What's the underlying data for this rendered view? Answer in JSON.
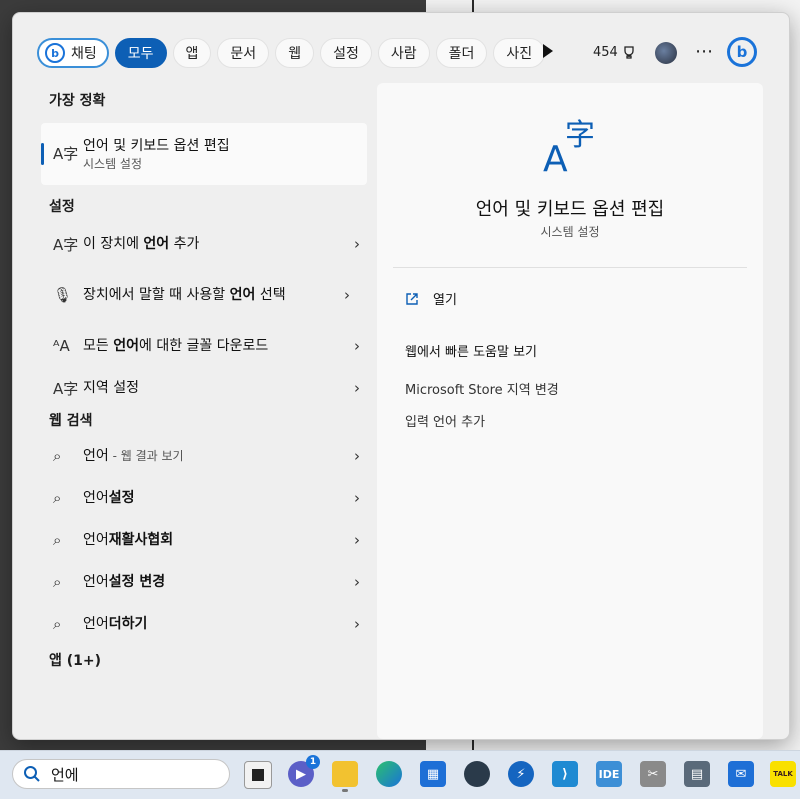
{
  "filters": {
    "chat_label": "채팅",
    "tabs": [
      "모두",
      "앱",
      "문서",
      "웹",
      "설정",
      "사람",
      "폴더",
      "사진"
    ],
    "active": "모두"
  },
  "points": "454",
  "more_icon": "⋯",
  "left": {
    "best_match": {
      "heading": "가장 정확",
      "title": "언어 및 키보드 옵션 편집",
      "subtitle": "시스템 설정"
    },
    "settings": {
      "heading": "설정",
      "items": [
        {
          "pre": "이 장치에 ",
          "bold": "언어",
          "post": " 추가",
          "icon": "language-icon"
        },
        {
          "pre": "장치에서 말할 때 사용할 ",
          "bold": "언어",
          "post": " 선택",
          "icon": "microphone-icon"
        },
        {
          "pre": "모든 ",
          "bold": "언어",
          "post": "에 대한 글꼴 다운로드",
          "icon": "font-icon"
        },
        {
          "pre": "지역 설정",
          "bold": "",
          "post": "",
          "icon": "language-icon"
        }
      ]
    },
    "web": {
      "heading": "웹 검색",
      "items": [
        {
          "pre": "언어",
          "bold": "",
          "post": "",
          "sub": " - 웹 결과 보기"
        },
        {
          "pre": "언어",
          "bold": "설정",
          "post": "",
          "sub": ""
        },
        {
          "pre": "언어",
          "bold": "재활사협회",
          "post": "",
          "sub": ""
        },
        {
          "pre": "언어",
          "bold": "설정 변경",
          "post": "",
          "sub": ""
        },
        {
          "pre": "언어",
          "bold": "더하기",
          "post": "",
          "sub": ""
        }
      ]
    },
    "apps_heading": "앱 (1+)"
  },
  "detail": {
    "title": "언어 및 키보드 옵션 편집",
    "subtitle": "시스템 설정",
    "open": "열기",
    "actions": [
      "웹에서 빠른 도움말 보기",
      "Microsoft Store 지역 변경",
      "입력 언어 추가"
    ]
  },
  "taskbar": {
    "search_value": "언에",
    "chat_badge": "1",
    "ide_label": "IDE",
    "talk_label": "TALK"
  }
}
